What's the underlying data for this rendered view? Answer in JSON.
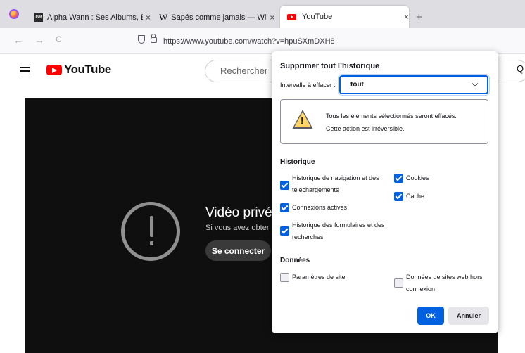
{
  "browser": {
    "tabs": [
      {
        "favicon": "genius-gr-icon",
        "title": "Alpha Wann : Ses Albums, Biogr",
        "close": "×"
      },
      {
        "favicon": "wikipedia-w-icon",
        "title": "Sapés comme jamais — Wikipé",
        "close": "×"
      },
      {
        "favicon": "youtube-icon",
        "title": "YouTube",
        "close": "×",
        "active": true
      }
    ],
    "new_tab": "+",
    "nav": {
      "back": "←",
      "forward": "→",
      "reload": "C"
    },
    "url": "https://www.youtube.com/watch?v=hpuSXmDXH8"
  },
  "youtube": {
    "logo_text": "YouTube",
    "search_placeholder": "Rechercher",
    "search_glyph": "Q",
    "video": {
      "title": "Vidéo privé",
      "subtitle": "Si vous avez obter",
      "signin_label": "Se connecter"
    }
  },
  "dialog": {
    "title": "Supprimer tout l’historique",
    "range_label": "Intervalle à effacer :",
    "range_value": "tout",
    "warning_line1": "Tous les éléments sélectionnés seront effacés.",
    "warning_line2": "Cette action est irréversible.",
    "history_heading": "Historique",
    "history_left": [
      {
        "line1": "Historique de navigation et des",
        "line2": "téléchargements",
        "checked": true
      },
      {
        "line1": "Connexions actives",
        "checked": true
      },
      {
        "line1": "Historique des formulaires et des",
        "line2": "recherches",
        "checked": true
      }
    ],
    "history_right": [
      {
        "line1": "Cookies",
        "checked": true
      },
      {
        "line1": "Cache",
        "checked": true
      }
    ],
    "data_heading": "Données",
    "data_left": [
      {
        "line1": "Paramètres de site",
        "checked": false
      }
    ],
    "data_right": [
      {
        "line1": "Données de sites web hors",
        "line2": "connexion",
        "checked": false
      }
    ],
    "ok_label": "OK",
    "cancel_label": "Annuler"
  },
  "colors": {
    "accent": "#0061e0",
    "tabstrip": "#dddde2",
    "video_bg": "#0f0f0f",
    "youtube_red": "#ff0000"
  }
}
